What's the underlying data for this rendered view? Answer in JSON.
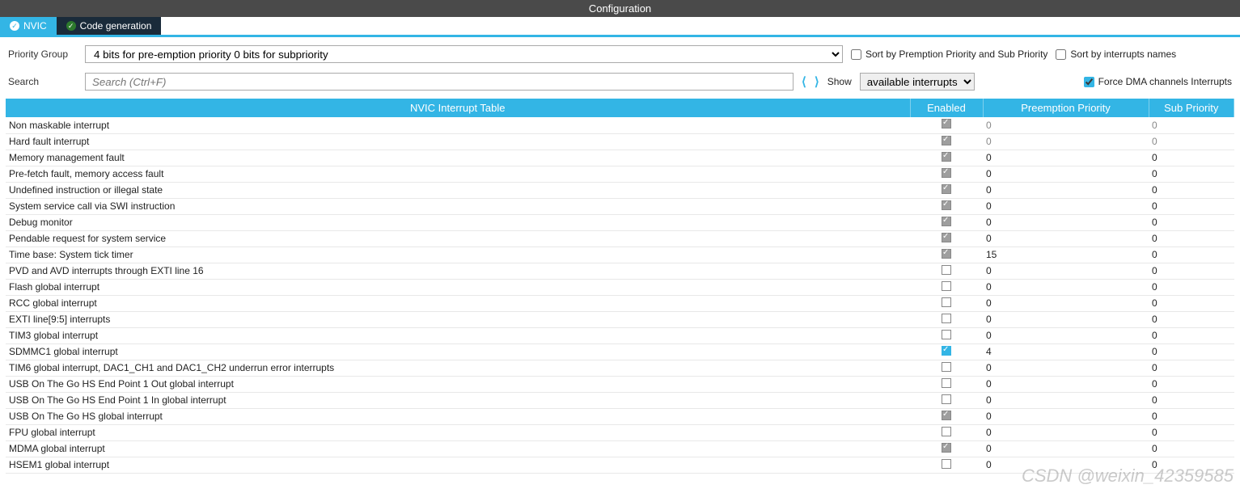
{
  "title": "Configuration",
  "tabs": {
    "nvic": "NVIC",
    "codegen": "Code generation"
  },
  "pg": {
    "label": "Priority Group",
    "value": "4 bits for pre-emption priority 0 bits for subpriority"
  },
  "cb_sort_prio": "Sort by Premption Priority and Sub Priority",
  "cb_sort_name": "Sort by interrupts names",
  "search": {
    "label": "Search",
    "placeholder": "Search (Ctrl+F)"
  },
  "show": {
    "label": "Show",
    "value": "available interrupts"
  },
  "cb_force": "Force DMA channels Interrupts",
  "cols": {
    "name": "NVIC Interrupt Table",
    "en": "Enabled",
    "pp": "Preemption Priority",
    "sp": "Sub Priority"
  },
  "rows": [
    {
      "n": "Non maskable interrupt",
      "en": true,
      "lock": true,
      "pp": "0",
      "sp": "0",
      "dim": true
    },
    {
      "n": "Hard fault interrupt",
      "en": true,
      "lock": true,
      "pp": "0",
      "sp": "0",
      "dim": true
    },
    {
      "n": "Memory management fault",
      "en": true,
      "lock": true,
      "pp": "0",
      "sp": "0"
    },
    {
      "n": "Pre-fetch fault, memory access fault",
      "en": true,
      "lock": true,
      "pp": "0",
      "sp": "0"
    },
    {
      "n": "Undefined instruction or illegal state",
      "en": true,
      "lock": true,
      "pp": "0",
      "sp": "0"
    },
    {
      "n": "System service call via SWI instruction",
      "en": true,
      "lock": true,
      "pp": "0",
      "sp": "0"
    },
    {
      "n": "Debug monitor",
      "en": true,
      "lock": true,
      "pp": "0",
      "sp": "0"
    },
    {
      "n": "Pendable request for system service",
      "en": true,
      "lock": true,
      "pp": "0",
      "sp": "0"
    },
    {
      "n": "Time base: System tick timer",
      "en": true,
      "lock": true,
      "pp": "15",
      "sp": "0"
    },
    {
      "n": "PVD and AVD interrupts through EXTI line 16",
      "en": false,
      "pp": "0",
      "sp": "0"
    },
    {
      "n": "Flash global interrupt",
      "en": false,
      "pp": "0",
      "sp": "0"
    },
    {
      "n": "RCC global interrupt",
      "en": false,
      "pp": "0",
      "sp": "0"
    },
    {
      "n": "EXTI line[9:5] interrupts",
      "en": false,
      "pp": "0",
      "sp": "0"
    },
    {
      "n": "TIM3 global interrupt",
      "en": false,
      "pp": "0",
      "sp": "0"
    },
    {
      "n": "SDMMC1 global interrupt",
      "en": true,
      "blue": true,
      "pp": "4",
      "sp": "0"
    },
    {
      "n": "TIM6 global interrupt, DAC1_CH1 and DAC1_CH2 underrun error interrupts",
      "en": false,
      "pp": "0",
      "sp": "0"
    },
    {
      "n": "USB On The Go HS End Point 1 Out global interrupt",
      "en": false,
      "pp": "0",
      "sp": "0"
    },
    {
      "n": "USB On The Go HS End Point 1 In global interrupt",
      "en": false,
      "pp": "0",
      "sp": "0"
    },
    {
      "n": "USB On The Go HS global interrupt",
      "en": true,
      "lock": true,
      "pp": "0",
      "sp": "0"
    },
    {
      "n": "FPU global interrupt",
      "en": false,
      "pp": "0",
      "sp": "0"
    },
    {
      "n": "MDMA global interrupt",
      "en": true,
      "lock": true,
      "pp": "0",
      "sp": "0"
    },
    {
      "n": "HSEM1 global interrupt",
      "en": false,
      "pp": "0",
      "sp": "0"
    }
  ],
  "watermark": "CSDN @weixin_42359585"
}
